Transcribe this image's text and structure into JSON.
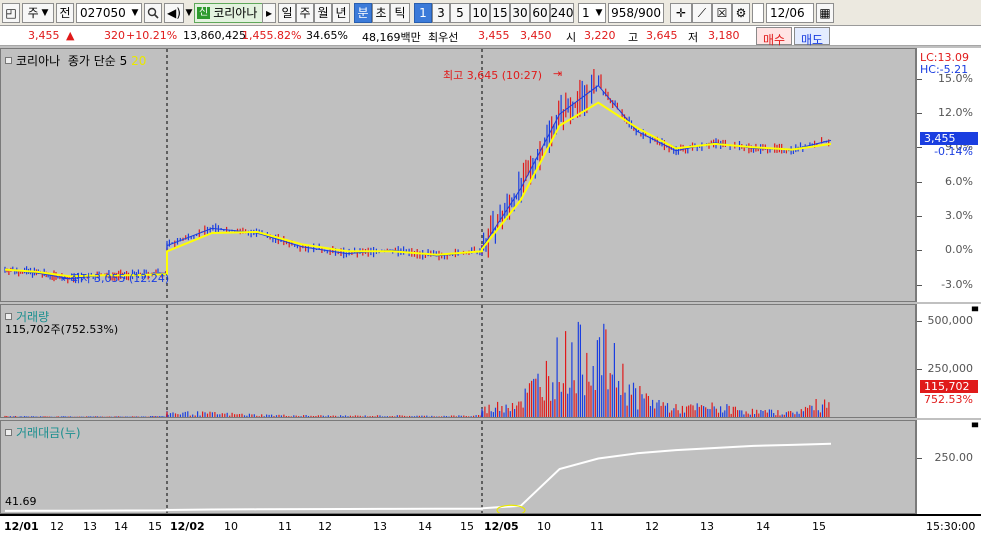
{
  "toolbar": {
    "type_select": "주",
    "prev_label": "전",
    "code_value": "027050",
    "stock_badge": "신",
    "stock_name": "코리아나",
    "period_tabs": [
      "일",
      "주",
      "월",
      "년",
      "분",
      "초",
      "틱"
    ],
    "active_period": "분",
    "interval_buttons": [
      "1",
      "3",
      "5",
      "10",
      "15",
      "30",
      "60",
      "240"
    ],
    "active_interval": "1",
    "multiplier_value": "1",
    "count_value": "958",
    "count_total": "/900",
    "date_value": "12/06"
  },
  "quote": {
    "price": "3,455",
    "change_arrow": "▲",
    "change": "320",
    "change_pct": "+10.21%",
    "volume": "13,860,425",
    "volume_pct": "1,455.82%",
    "turnover": "34.65%",
    "amount": "48,169백만",
    "best_ask_label": "최우선",
    "best_ask": "3,455",
    "best_bid": "3,450",
    "open_label": "시",
    "open": "3,220",
    "high_label": "고",
    "high": "3,645",
    "low_label": "저",
    "low": "3,180",
    "buy_label": "매수",
    "sell_label": "매도"
  },
  "colors": {
    "up": "#e01a1a",
    "down": "#1a3ee0",
    "ma": "#ffff00",
    "background": "#c0c0c0",
    "cumulative": "#ffffff"
  },
  "price_pane": {
    "stock_label": "코리아나",
    "ma_label": "종가 단순 5",
    "ma_value": "20",
    "lc_label": "LC:13.09",
    "hc_label": "HC:-5.21",
    "high_annotation": "최고 3,645 (10:27)",
    "low_annotation": "최저 3,055 (12:24)",
    "current_price_tag": "3,455",
    "current_pct_tag": "-0.14%",
    "y_ticks": [
      "15.0%",
      "12.0%",
      "9.0%",
      "6.0%",
      "3.0%",
      "0.0%",
      "-3.0%"
    ]
  },
  "volume_pane": {
    "label": "거래량",
    "current": "115,702주(752.53%)",
    "tag_value": "115,702",
    "tag_pct": "752.53%",
    "y_ticks": [
      "500,000",
      "250,000"
    ]
  },
  "amount_pane": {
    "label": "거래대금(누)",
    "left_value": "41.69",
    "y_ticks": [
      "250.00"
    ]
  },
  "time_axis": {
    "labels": [
      "12/01",
      "12",
      "13",
      "14",
      "15",
      "12/02",
      "10",
      "11",
      "12",
      "13",
      "14",
      "15",
      "12/05",
      "10",
      "11",
      "12",
      "13",
      "14",
      "15"
    ],
    "clock": "15:30:00"
  },
  "chart_data": {
    "type": "line",
    "title": "",
    "xlabel": "",
    "ylabel": "",
    "sessions": [
      "12/01",
      "12/02",
      "12/05"
    ],
    "price_pct_series": {
      "name": "코리아나",
      "x": [
        "12/01 11:30",
        "12/01 12:00",
        "12/01 12:24",
        "12/01 13:00",
        "12/01 14:00",
        "12/01 15:30",
        "12/02 09:00",
        "12/02 09:30",
        "12/02 10:00",
        "12/02 11:00",
        "12/02 12:00",
        "12/02 13:00",
        "12/02 14:00",
        "12/02 15:30",
        "12/05 09:00",
        "12/05 09:30",
        "12/05 10:00",
        "12/05 10:27",
        "12/05 11:00",
        "12/05 12:00",
        "12/05 13:00",
        "12/05 14:00",
        "12/05 15:00",
        "12/05 15:30"
      ],
      "values": [
        -1.6,
        -1.9,
        -2.4,
        -2.1,
        -2.1,
        -1.9,
        0.5,
        2.0,
        1.6,
        0.4,
        -0.2,
        0.1,
        -0.4,
        0.0,
        0.3,
        5.5,
        12.0,
        14.5,
        10.5,
        8.8,
        9.5,
        9.0,
        8.9,
        9.7
      ]
    },
    "ma_series": {
      "name": "종가 단순 5",
      "values": [
        -1.6,
        -1.8,
        -2.2,
        -2.1,
        -2.1,
        -2.0,
        0.0,
        1.6,
        1.7,
        0.6,
        0.0,
        0.0,
        -0.3,
        0.0,
        0.2,
        4.5,
        11.0,
        13.0,
        10.8,
        9.0,
        9.4,
        9.1,
        8.9,
        9.4
      ]
    },
    "volume_series": {
      "name": "거래량",
      "values": [
        5000,
        4000,
        3000,
        4000,
        3000,
        6000,
        30000,
        25000,
        15000,
        10000,
        8000,
        9000,
        7000,
        10000,
        50000,
        120000,
        400000,
        480000,
        150000,
        60000,
        70000,
        40000,
        30000,
        115702
      ]
    },
    "cumulative_amount_series": {
      "name": "거래대금(누)",
      "values": [
        0.5,
        1.0,
        1.5,
        2.0,
        2.5,
        3.0,
        5.0,
        7.0,
        8.0,
        9.0,
        9.5,
        10.0,
        10.5,
        11.0,
        13.0,
        25.0,
        200.0,
        250.0,
        275.0,
        290.0,
        300.0,
        310.0,
        315.0,
        320.0
      ]
    },
    "price_ylim": [
      -4.0,
      17.0
    ],
    "volume_ylim": [
      0,
      560000
    ],
    "amount_ylim": [
      0,
      400
    ],
    "grid": false,
    "legend": "top-left"
  }
}
